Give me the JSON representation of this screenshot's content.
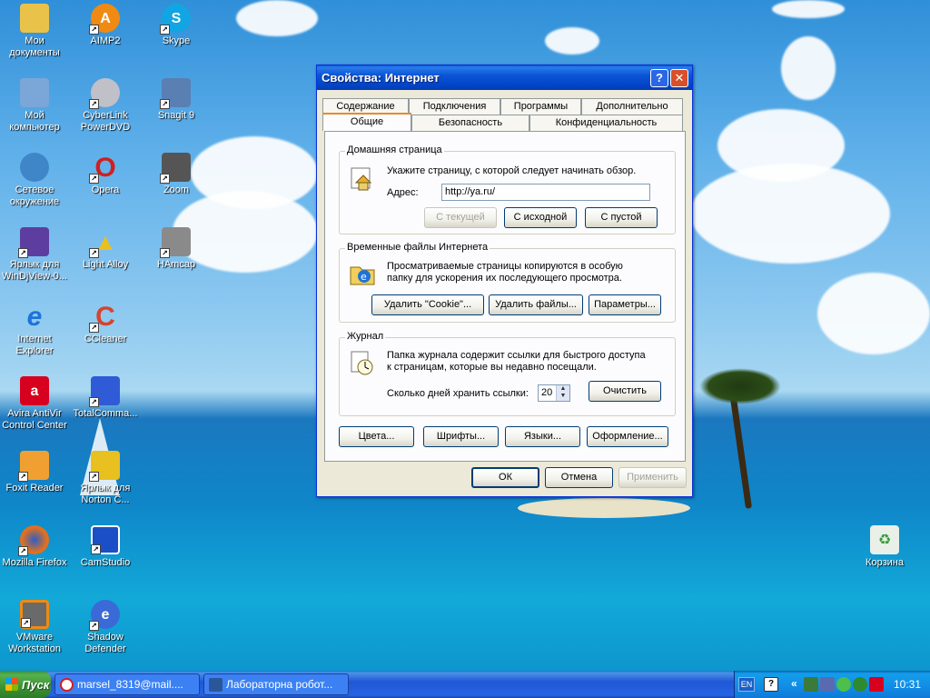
{
  "desktop_icons": [
    {
      "label": "Мои документы",
      "icon": "my-documents-icon",
      "color": "#e9c24a"
    },
    {
      "label": "AIMP2",
      "icon": "aimp-icon",
      "color": "#f08a12"
    },
    {
      "label": "Skype",
      "icon": "skype-icon",
      "color": "#12a5e3"
    },
    {
      "label": "Мой компьютер",
      "icon": "my-computer-icon",
      "color": "#7aa6d8"
    },
    {
      "label": "CyberLink PowerDVD",
      "icon": "powerdvd-icon",
      "color": "#c0c0c8"
    },
    {
      "label": "Snagit 9",
      "icon": "snagit-icon",
      "color": "#5a7fb3"
    },
    {
      "label": "Сетевое окружение",
      "icon": "network-icon",
      "color": "#3f86c8"
    },
    {
      "label": "Opera",
      "icon": "opera-icon",
      "color": "#d11f1f"
    },
    {
      "label": "Zoom",
      "icon": "zoom-icon",
      "color": "#555555"
    },
    {
      "label": "Ярлык для WinDjView-0...",
      "icon": "windjview-icon",
      "color": "#5d3ea0"
    },
    {
      "label": "Light Alloy",
      "icon": "light-alloy-icon",
      "color": "#3a7bd5"
    },
    {
      "label": "HAmcap",
      "icon": "hamcap-icon",
      "color": "#8a8a8a"
    },
    {
      "label": "Internet Explorer",
      "icon": "internet-explorer-icon",
      "color": "#1e73d8"
    },
    {
      "label": "CCleaner",
      "icon": "ccleaner-icon",
      "color": "#d8432a"
    },
    {
      "label": "Avira AntiVir Control Center",
      "icon": "avira-icon",
      "color": "#d8001f"
    },
    {
      "label": "TotalComma...",
      "icon": "total-commander-icon",
      "color": "#2f5bd6"
    },
    {
      "label": "Foxit Reader",
      "icon": "foxit-icon",
      "color": "#f0a030"
    },
    {
      "label": "Ярлык для Norton C...",
      "icon": "norton-icon",
      "color": "#e8c020"
    },
    {
      "label": "Mozilla Firefox",
      "icon": "firefox-icon",
      "color": "#e07020"
    },
    {
      "label": "CamStudio",
      "icon": "camstudio-icon",
      "color": "#1a4fc8"
    },
    {
      "label": "VMware Workstation",
      "icon": "vmware-icon",
      "color": "#6a6a6a"
    },
    {
      "label": "Shadow Defender",
      "icon": "shadow-defender-icon",
      "color": "#3a6ad8"
    },
    {
      "label": "Корзина",
      "icon": "recycle-bin-icon",
      "color": "#5fa85f"
    }
  ],
  "dialog": {
    "title": "Свойства: Интернет",
    "help_glyph": "?",
    "close_glyph": "✕",
    "tabs_back": [
      "Содержание",
      "Подключения",
      "Программы",
      "Дополнительно"
    ],
    "tabs_front": [
      "Общие",
      "Безопасность",
      "Конфиденциальность"
    ],
    "home": {
      "title": "Домашняя страница",
      "desc": "Укажите страницу, с которой следует начинать обзор.",
      "address_label": "Адрес:",
      "address_value": "http://ya.ru/",
      "btn_current": "С текущей",
      "btn_default": "С исходной",
      "btn_blank": "С пустой"
    },
    "temp": {
      "title": "Временные файлы Интернета",
      "desc_line1": "Просматриваемые страницы копируются в особую",
      "desc_line2": "папку для ускорения их последующего просмотра.",
      "btn_cookies": "Удалить \"Cookie\"...",
      "btn_files": "Удалить файлы...",
      "btn_settings": "Параметры..."
    },
    "history": {
      "title": "Журнал",
      "desc_line1": "Папка журнала содержит ссылки для быстрого доступа",
      "desc_line2": "к страницам, которые вы недавно посещали.",
      "days_label": "Сколько дней хранить ссылки:",
      "days_value": "20",
      "btn_clear": "Очистить"
    },
    "bottom_buttons": {
      "colors": "Цвета...",
      "fonts": "Шрифты...",
      "languages": "Языки...",
      "accessibility": "Оформление..."
    },
    "footer": {
      "ok": "ОК",
      "cancel": "Отмена",
      "apply": "Применить"
    }
  },
  "taskbar": {
    "start_label": "Пуск",
    "tasks": [
      {
        "label": "marsel_8319@mail....",
        "icon": "opera-icon",
        "color": "#d11f1f"
      },
      {
        "label": "Лабораторна робот...",
        "icon": "word-icon",
        "color": "#2b579a"
      }
    ],
    "language": "EN",
    "clock": "10:31"
  }
}
